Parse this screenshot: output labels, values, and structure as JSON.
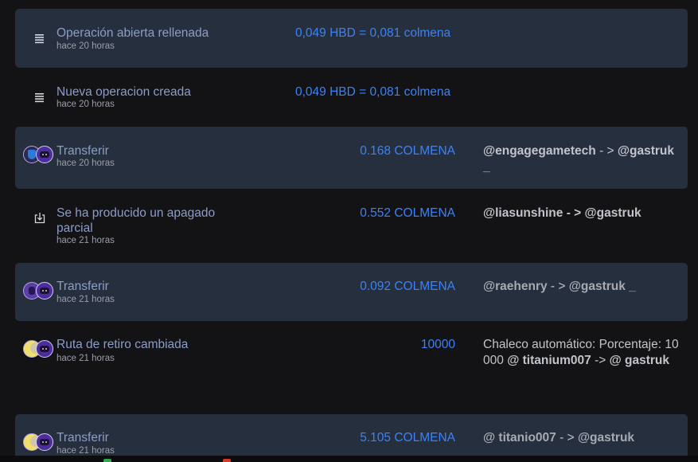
{
  "rows": [
    {
      "kind": "op",
      "title": "Operación abierta rellenada",
      "time": "hace 20 horas",
      "amount": "0,049 HBD = 0,081 colmena"
    },
    {
      "kind": "op",
      "title": "Nueva operacion creada",
      "time": "hace 20 horas",
      "amount": "0,049 HBD = 0,081 colmena"
    },
    {
      "kind": "transfer",
      "title": "Transferir",
      "time": "hace 20 horas",
      "amount": "0.168 COLMENA",
      "from": "@engagegametech",
      "arrow": "- >",
      "to": "@gastruk _"
    },
    {
      "kind": "powerdown",
      "title": "Se ha producido un apagado parcial",
      "time": "hace 21 horas",
      "amount": "0.552 COLMENA",
      "from": "@liasunshine",
      "arrow": "- >",
      "to": "@gastruk"
    },
    {
      "kind": "transfer",
      "title": "Transferir",
      "time": "hace 21 horas",
      "amount": "0.092 COLMENA",
      "from": "@raehenry",
      "arrow": "- >",
      "to": "@gastruk _"
    },
    {
      "kind": "route",
      "title": "Ruta de retiro cambiada",
      "time": "hace 21 horas",
      "amount": "10000",
      "prefix": "Chaleco automático: Porcentaje: 10000",
      "from": "@ titanium007",
      "arrow": "->",
      "to": "@ gastruk"
    },
    {
      "kind": "transfer",
      "title": "Transferir",
      "time": "hace 21 horas",
      "amount": "5.105 COLMENA",
      "from": "@ titanio007",
      "arrow": "- >",
      "to": "@gastruk"
    }
  ],
  "colors": {
    "background": "#131316",
    "row_shade": "#262f3e",
    "title": "#8b9dc8",
    "amount": "#3b82f6",
    "detail": "#c1c4ca"
  }
}
